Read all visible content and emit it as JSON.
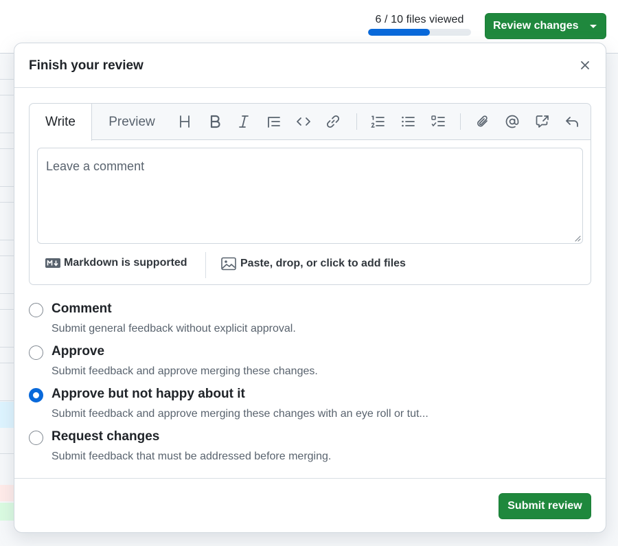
{
  "topbar": {
    "files_viewed": "6 / 10 files viewed",
    "files_viewed_fraction": 0.6,
    "review_button_label": "Review changes"
  },
  "modal": {
    "title": "Finish your review",
    "tabs": {
      "write": "Write",
      "preview": "Preview"
    },
    "toolbar": [
      "heading-icon",
      "bold-icon",
      "italic-icon",
      "quote-icon",
      "code-icon",
      "link-icon",
      "numbered-list-icon",
      "unordered-list-icon",
      "task-list-icon",
      "attach-icon",
      "mention-icon",
      "cross-reference-icon",
      "reply-icon"
    ],
    "comment_placeholder": "Leave a comment",
    "markdown_label": "Markdown is supported",
    "attach_label": "Paste, drop, or click to add files",
    "options": [
      {
        "title": "Comment",
        "description": "Submit general feedback without explicit approval.",
        "checked": false
      },
      {
        "title": "Approve",
        "description": "Submit feedback and approve merging these changes.",
        "checked": false
      },
      {
        "title": "Approve but not happy about it",
        "description": "Submit feedback and approve merging these changes with an eye roll or tut...",
        "checked": true
      },
      {
        "title": "Request changes",
        "description": "Submit feedback that must be addressed before merging.",
        "checked": false
      }
    ],
    "submit_label": "Submit review"
  },
  "colors": {
    "primary_button": "#1f883d",
    "accent_blue": "#0969da",
    "border": "#d0d7de"
  }
}
